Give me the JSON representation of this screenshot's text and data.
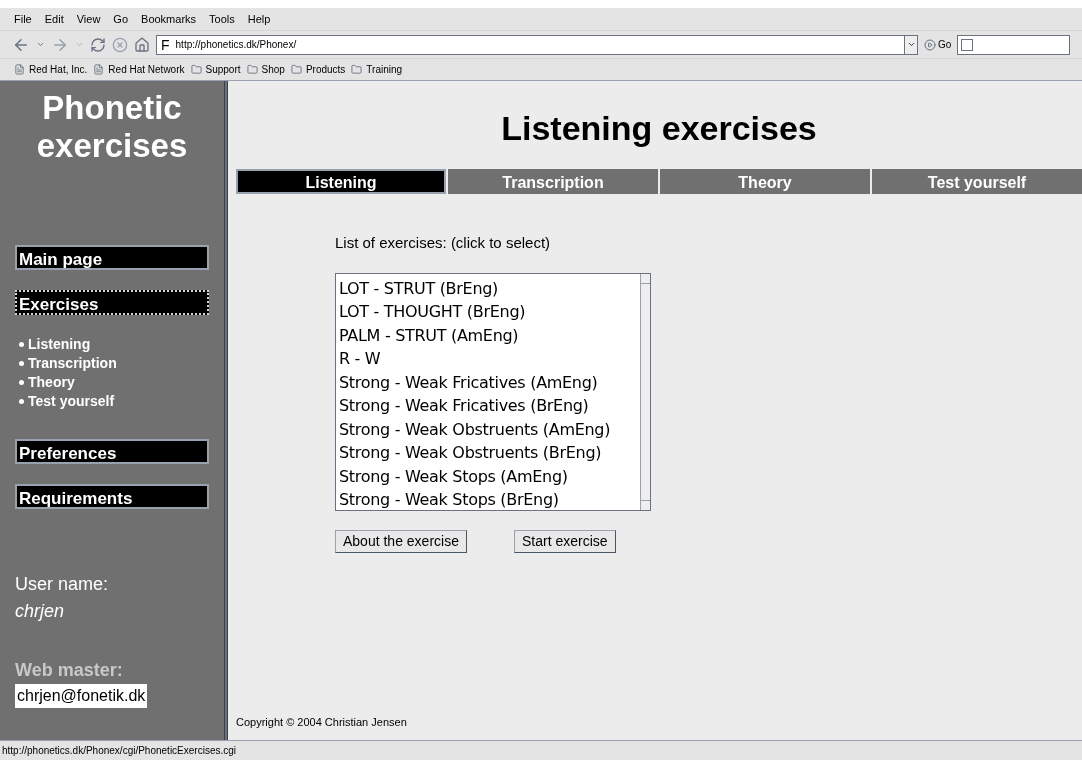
{
  "menu": [
    "File",
    "Edit",
    "View",
    "Go",
    "Bookmarks",
    "Tools",
    "Help"
  ],
  "toolbar": {
    "site_icon": "F",
    "url": "http://phonetics.dk/Phonex/",
    "go": "Go"
  },
  "bookmarks": [
    {
      "label": "Red Hat, Inc.",
      "kind": "page"
    },
    {
      "label": "Red Hat Network",
      "kind": "page"
    },
    {
      "label": "Support",
      "kind": "folder"
    },
    {
      "label": "Shop",
      "kind": "folder"
    },
    {
      "label": "Products",
      "kind": "folder"
    },
    {
      "label": "Training",
      "kind": "folder"
    }
  ],
  "sidebar": {
    "title": "Phonetic exercises",
    "items": [
      {
        "label": "Main page",
        "selected": false
      },
      {
        "label": "Exercises",
        "selected": true,
        "children": [
          {
            "label": "Listening"
          },
          {
            "label": "Transcription"
          },
          {
            "label": "Theory"
          },
          {
            "label": "Test yourself"
          }
        ]
      },
      {
        "label": "Preferences",
        "selected": false
      },
      {
        "label": "Requirements",
        "selected": false
      }
    ],
    "user_label": "User name:",
    "user_name": "chrjen",
    "webmaster_label": "Web master:",
    "webmaster_email": "chrjen@fonetik.dk"
  },
  "page": {
    "title": "Listening exercises",
    "tabs": [
      {
        "label": "Listening",
        "selected": true
      },
      {
        "label": "Transcription",
        "selected": false
      },
      {
        "label": "Theory",
        "selected": false
      },
      {
        "label": "Test yourself",
        "selected": false
      }
    ],
    "list_label": "List of exercises: (click to select)",
    "exercises": [
      "LOT - STRUT (BrEng)",
      "LOT - THOUGHT (BrEng)",
      "PALM - STRUT (AmEng)",
      "R - W",
      "Strong - Weak Fricatives (AmEng)",
      "Strong - Weak Fricatives (BrEng)",
      "Strong - Weak Obstruents (AmEng)",
      "Strong - Weak Obstruents (BrEng)",
      "Strong - Weak Stops (AmEng)",
      "Strong - Weak Stops (BrEng)"
    ],
    "buttons": [
      "About the exercise",
      "Start exercise"
    ],
    "copyright": "Copyright © 2004 Christian Jensen"
  },
  "status_bar": "http://phonetics.dk/Phonex/cgi/PhoneticExercises.cgi"
}
